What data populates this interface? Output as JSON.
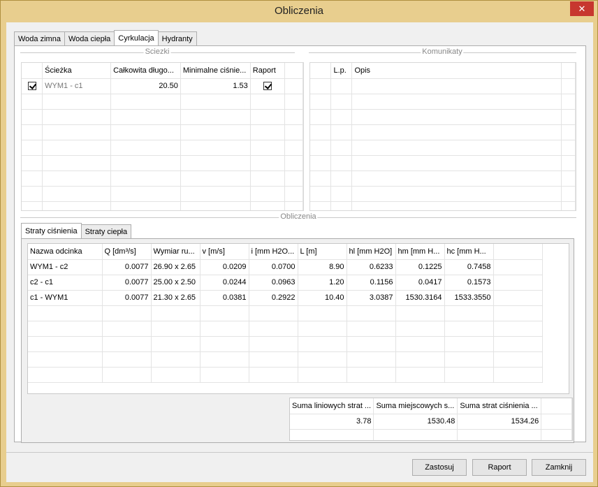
{
  "window": {
    "title": "Obliczenia",
    "close_glyph": "✕"
  },
  "main_tabs": [
    "Woda zimna",
    "Woda ciepła",
    "Cyrkulacja",
    "Hydranty"
  ],
  "sciezki": {
    "label": "Sciezki",
    "headers": [
      "",
      "Ścieżka",
      "Całkowita długo...",
      "Minimalne ciśnie...",
      "Raport",
      ""
    ],
    "rows": [
      {
        "checked": true,
        "name": "WYM1 - c1",
        "length": "20.50",
        "pressure": "1.53",
        "report": true
      }
    ]
  },
  "komunikaty": {
    "label": "Komunikaty",
    "headers": [
      "",
      "L.p.",
      "Opis",
      ""
    ]
  },
  "obliczenia": {
    "label": "Obliczenia",
    "tabs": [
      "Straty ciśnienia",
      "Straty ciepła"
    ],
    "headers": [
      "Nazwa odcinka",
      "Q [dm³/s]",
      "Wymiar ru...",
      "v [m/s]",
      "i [mm H2O...",
      "L [m]",
      "hl [mm H2O]",
      "hm [mm H...",
      "hc [mm H...",
      ""
    ],
    "rows": [
      [
        "WYM1 - c2",
        "0.0077",
        "26.90 x 2.65",
        "0.0209",
        "0.0700",
        "8.90",
        "0.6233",
        "0.1225",
        "0.7458"
      ],
      [
        "c2 - c1",
        "0.0077",
        "25.00 x 2.50",
        "0.0244",
        "0.0963",
        "1.20",
        "0.1156",
        "0.0417",
        "0.1573"
      ],
      [
        "c1 - WYM1",
        "0.0077",
        "21.30 x 2.65",
        "0.0381",
        "0.2922",
        "10.40",
        "3.0387",
        "1530.3164",
        "1533.3550"
      ]
    ],
    "summary_headers": [
      "Suma liniowych strat ...",
      "Suma miejscowych s...",
      "Suma strat ciśnienia ...",
      ""
    ],
    "summary_values": [
      "3.78",
      "1530.48",
      "1534.26",
      ""
    ]
  },
  "buttons": {
    "apply": "Zastosuj",
    "report": "Raport",
    "close": "Zamknij"
  }
}
